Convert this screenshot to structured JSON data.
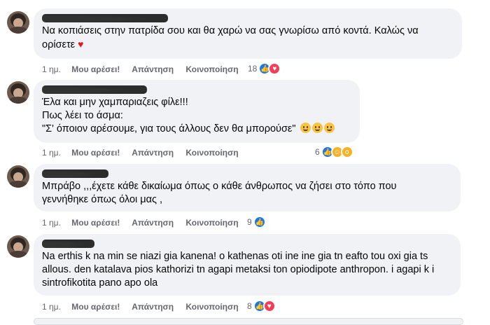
{
  "comments": [
    {
      "text_lines": [
        "Να κοπιάσεις στην πατρίδα σου και θα χαρώ να σας γνωρίσω από κοντά. Καλώς να",
        "ορίσετε"
      ],
      "trailing_icon": "red-heart-emoji",
      "time": "1 ημ.",
      "like": "Μου αρέσει!",
      "reply": "Απάντηση",
      "share": "Κοινοποίηση",
      "reaction_count": "18",
      "reactions": [
        "like-icon",
        "love-icon"
      ]
    },
    {
      "text_lines": [
        "Έλα και μην χαμπαριαζεις φίλε!!!",
        "Πως λέει το άσμα:",
        "\"Σ' όποιον αρέσουμε, για τους άλλους δεν θα μπορούσε\""
      ],
      "trailing_icon": "smile-emoji",
      "time": "1 ημ.",
      "like": "Μου αρέσει!",
      "reply": "Απάντηση",
      "share": "Κοινοποίηση",
      "reaction_count": "6",
      "reactions": [
        "like-icon",
        "care-icon",
        "wow-icon"
      ]
    },
    {
      "text_lines": [
        "Μπράβο ,,,έχετε κάθε δικαίωμα όπως ο κάθε άνθρωπος να ζήσει στο τόπο που",
        "γεννήθηκε όπως όλοι μας ,"
      ],
      "time": "1 ημ.",
      "like": "Μου αρέσει!",
      "reply": "Απάντηση",
      "share": "Κοινοποίηση",
      "reaction_count": "9",
      "reactions": [
        "like-icon"
      ]
    },
    {
      "text_lines": [
        "Na erthis k na min se niazi gia kanena! o kathenas oti ine ine gia tn eafto tou oxi gia ts",
        "allous. den katalava pios kathorizi tn agapi metaksi ton opiodipote anthropon. i agapi k i",
        "sintrofikotita pano apo ola"
      ],
      "time": "1 ημ.",
      "like": "Μου αρέσει!",
      "reply": "Απάντηση",
      "share": "Κοινοποίηση",
      "reaction_count": "8",
      "reactions": [
        "like-icon",
        "love-icon"
      ]
    }
  ],
  "colors": {
    "bubble": "#f0f2f5",
    "meta_text": "#65676b",
    "like_blue": "#1877f2",
    "love_red": "#f33e58",
    "care_yellow": "#f7b125"
  }
}
